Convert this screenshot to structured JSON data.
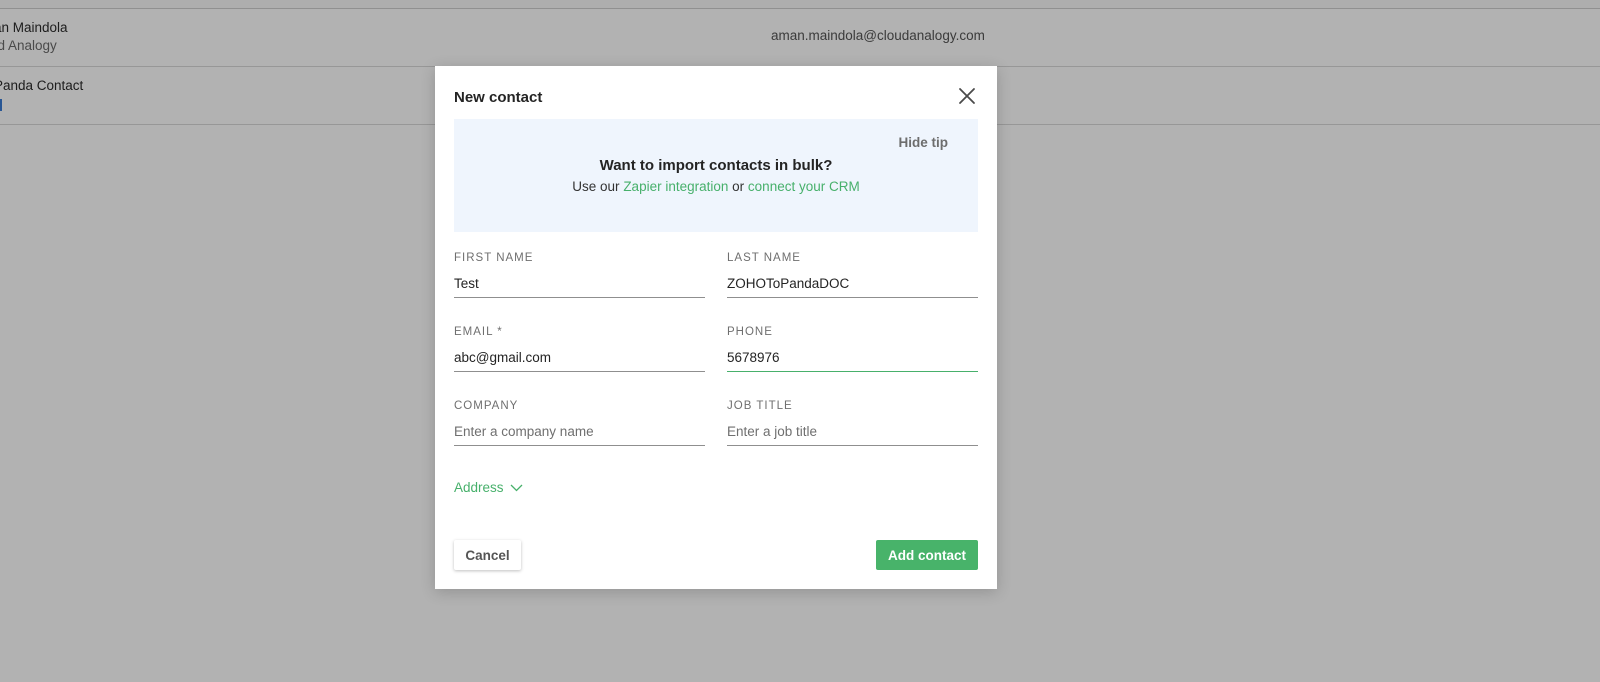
{
  "background_list": {
    "rows": [
      {
        "name": "an Maindola",
        "subtitle": "ud Analogy",
        "email": "aman.maindola@cloudanalogy.com"
      },
      {
        "name": "Panda Contact",
        "subtitle": "",
        "email": ""
      }
    ]
  },
  "modal": {
    "title": "New contact",
    "close_icon": "close-icon",
    "tip": {
      "hide_label": "Hide tip",
      "title": "Want to import contacts in bulk?",
      "text_prefix": "Use our",
      "zapier_link": "Zapier integration",
      "text_middle": "or",
      "crm_link": "connect your CRM"
    },
    "fields": {
      "first_name": {
        "label": "FIRST NAME",
        "value": "Test",
        "placeholder": ""
      },
      "last_name": {
        "label": "LAST NAME",
        "value": "ZOHOToPandaDOC",
        "placeholder": ""
      },
      "email": {
        "label": "EMAIL *",
        "value": "abc@gmail.com",
        "placeholder": ""
      },
      "phone": {
        "label": "PHONE",
        "value": "5678976",
        "placeholder": ""
      },
      "company": {
        "label": "COMPANY",
        "value": "",
        "placeholder": "Enter a company name"
      },
      "job_title": {
        "label": "JOB TITLE",
        "value": "",
        "placeholder": "Enter a job title"
      }
    },
    "address_label": "Address",
    "address_icon": "chevron-down-icon",
    "cancel_label": "Cancel",
    "add_label": "Add contact"
  },
  "colors": {
    "accent_green": "#48b36a",
    "link_green": "#47b06b",
    "tip_background": "#eff5fd",
    "overlay": "rgba(0,0,0,0.30)"
  }
}
